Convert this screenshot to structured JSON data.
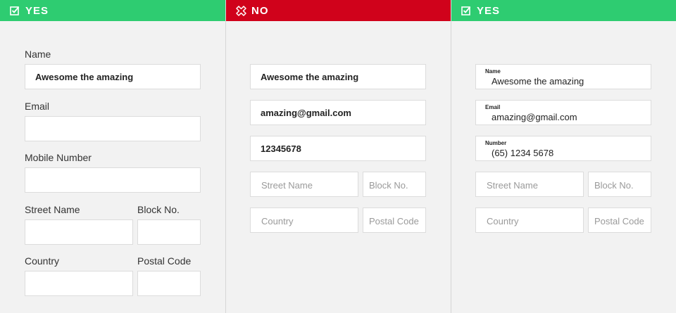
{
  "panels": [
    {
      "status": "YES",
      "status_icon": "checkbox-check-icon",
      "color": "#2ecc71",
      "labels": {
        "name": "Name",
        "email": "Email",
        "mobile": "Mobile Number",
        "street": "Street Name",
        "block": "Block No.",
        "country": "Country",
        "postal": "Postal Code"
      },
      "values": {
        "name": "Awesome the amazing",
        "email": "",
        "mobile": "",
        "street": "",
        "block": "",
        "country": "",
        "postal": ""
      }
    },
    {
      "status": "NO",
      "status_icon": "cross-badge-icon",
      "color": "#d0021b",
      "values": {
        "name": "Awesome the amazing",
        "email": "amazing@gmail.com",
        "number": "12345678"
      },
      "placeholders": {
        "street": "Street Name",
        "block": "Block No.",
        "country": "Country",
        "postal": "Postal Code"
      }
    },
    {
      "status": "YES",
      "status_icon": "checkbox-check-icon",
      "color": "#2ecc71",
      "float_labels": {
        "name": "Name",
        "email": "Email",
        "number": "Number"
      },
      "values": {
        "name": "Awesome the amazing",
        "email": "amazing@gmail.com",
        "number": "(65) 1234 5678"
      },
      "placeholders": {
        "street": "Street Name",
        "block": "Block No.",
        "country": "Country",
        "postal": "Postal Code"
      }
    }
  ]
}
